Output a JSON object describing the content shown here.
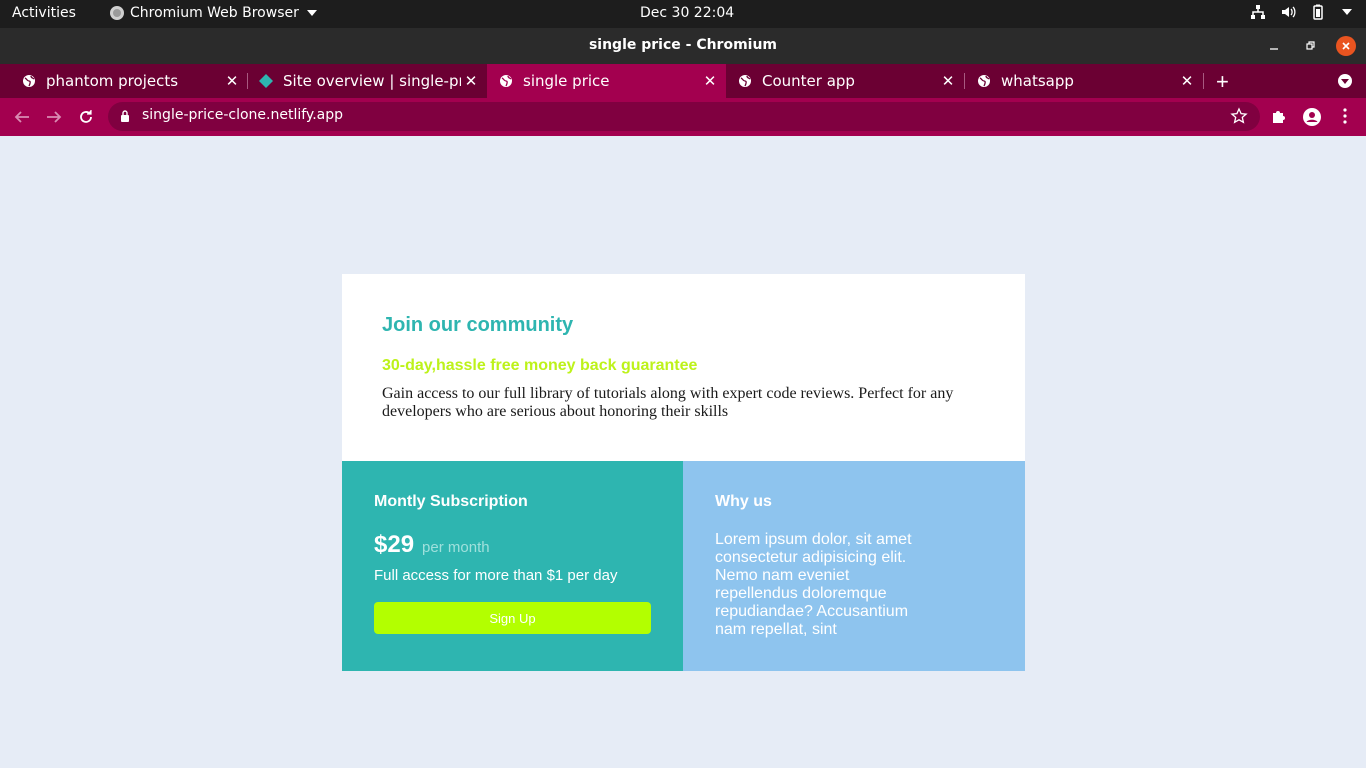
{
  "system_bar": {
    "activities": "Activities",
    "app_name": "Chromium Web Browser",
    "clock": "Dec 30  22:04"
  },
  "window": {
    "title": "single price - Chromium"
  },
  "tabs": [
    {
      "title": "phantom projects",
      "icon": "globe-icon",
      "active": false
    },
    {
      "title": "Site overview | single-price",
      "icon": "netlify-diamond-icon",
      "active": false
    },
    {
      "title": "single price",
      "icon": "globe-icon",
      "active": true
    },
    {
      "title": "Counter app",
      "icon": "globe-icon",
      "active": false
    },
    {
      "title": "whatsapp",
      "icon": "globe-icon",
      "active": false
    }
  ],
  "omnibox": {
    "url": "single-price-clone.netlify.app"
  },
  "page": {
    "heading": "Join our community",
    "subheading": "30-day,hassle free money back guarantee",
    "intro": "Gain access to our full library of tutorials along with expert code reviews. Perfect for any developers who are serious about honoring their skills",
    "subscription": {
      "title": "Montly Subscription",
      "price": "$29",
      "period": "per month",
      "access": "Full access for more than $1 per day",
      "button": "Sign Up"
    },
    "why_us": {
      "title": "Why us",
      "text": "Lorem ipsum dolor, sit amet consectetur adipisicing elit. Nemo nam eveniet repellendus doloremque repudiandae? Accusantium nam repellat, sint"
    }
  },
  "colors": {
    "accent_teal": "#2eb5b0",
    "accent_lime": "#b3ff00",
    "light_blue": "#8ec4ee",
    "browser_theme": "#a3004f"
  }
}
